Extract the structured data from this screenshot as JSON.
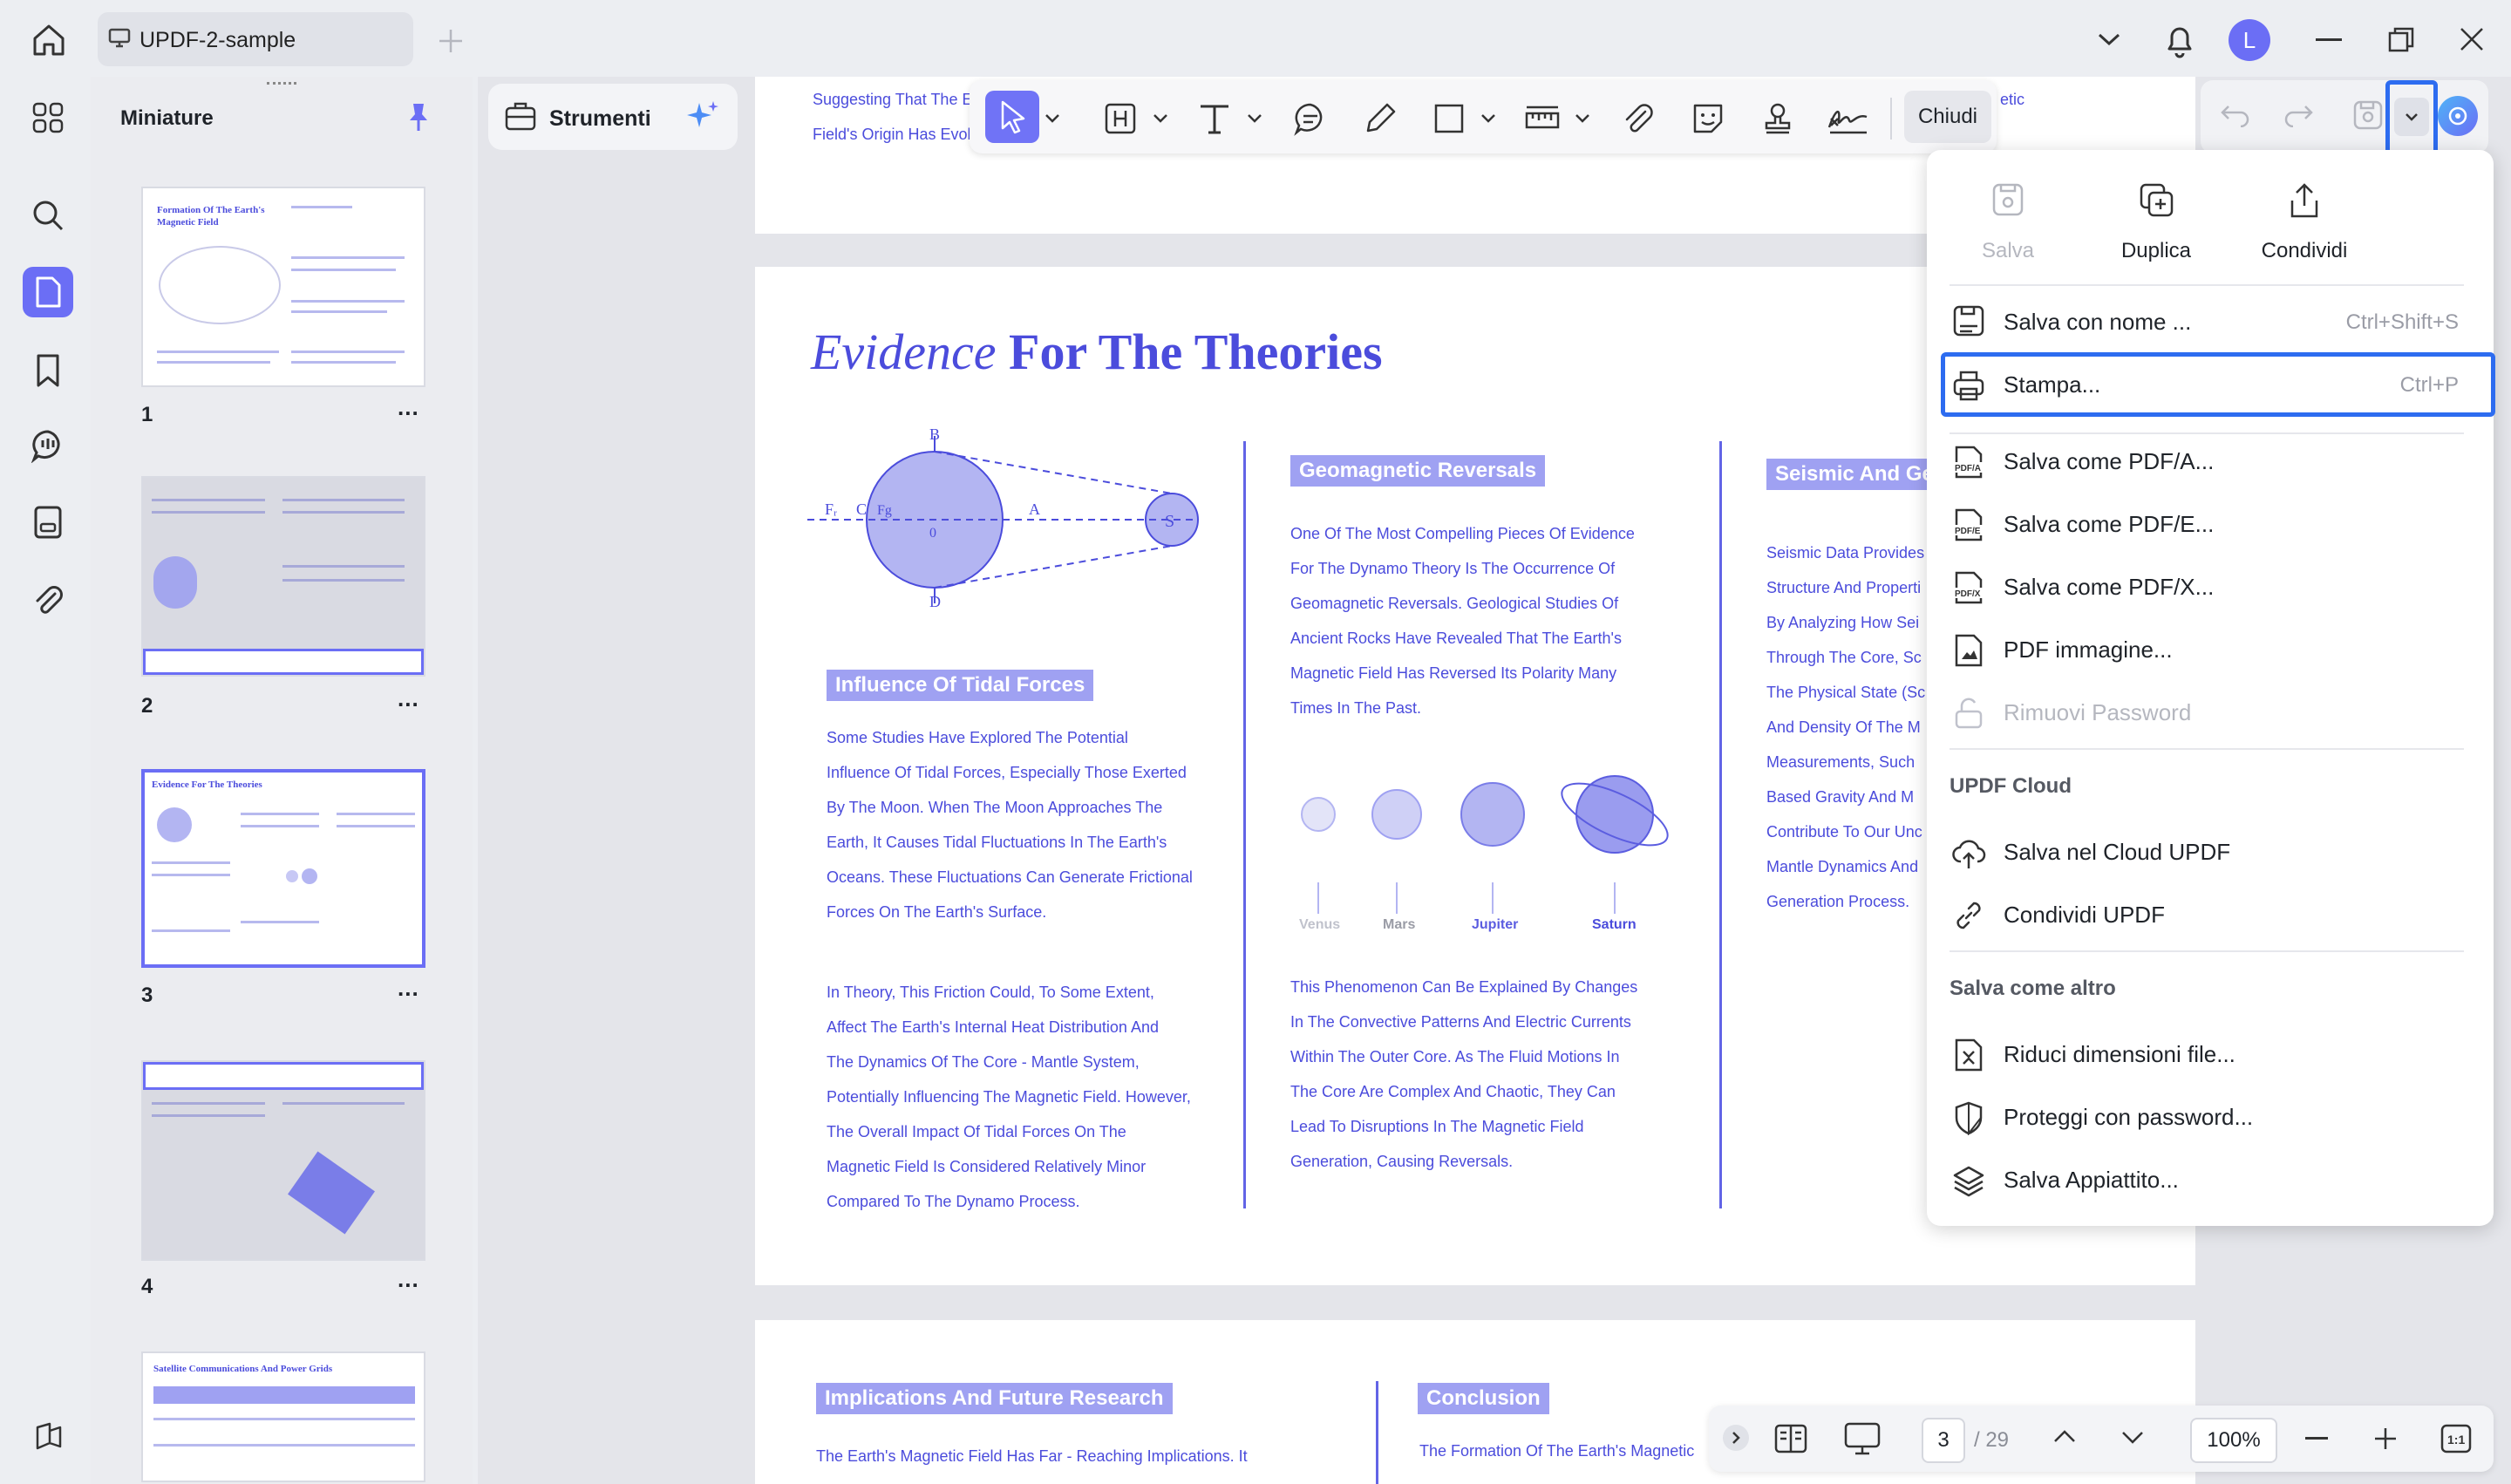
{
  "window": {
    "tab_title": "UPDF-2-sample",
    "avatar_letter": "L"
  },
  "thumbnails": {
    "title": "Miniature",
    "pages": [
      {
        "num": "1",
        "title": "Formation Of The Earth's Magnetic Field"
      },
      {
        "num": "2",
        "title": ""
      },
      {
        "num": "3",
        "title": "Evidence For The Theories"
      },
      {
        "num": "4",
        "title": ""
      },
      {
        "num": "",
        "title": "Satellite Communications And Power Grids"
      }
    ],
    "more": "..."
  },
  "tools": {
    "strumenti_label": "Strumenti",
    "chiudi_label": "Chiudi"
  },
  "document": {
    "top_fragment_1": "Suggesting That The E",
    "top_fragment_2": "Field's Origin Has Evol",
    "top_fragment_3": "etic",
    "page_title_italic": "Evidence",
    "page_title_bold": "For The Theories",
    "tidal_heading": "Influence Of Tidal Forces",
    "tidal_p1": [
      "Some Studies Have Explored The Potential",
      "Influence Of Tidal Forces, Especially Those Exerted",
      "By The Moon. When The Moon Approaches The",
      "Earth, It Causes Tidal Fluctuations In The Earth's",
      "Oceans. These Fluctuations Can Generate Frictional",
      "Forces On The Earth's Surface."
    ],
    "tidal_p2": [
      "In Theory, This Friction Could, To Some Extent,",
      "Affect The Earth's Internal Heat Distribution And",
      "The Dynamics Of The Core - Mantle System,",
      "Potentially Influencing The Magnetic Field. However,",
      "The Overall Impact Of Tidal Forces On The",
      "Magnetic Field Is Considered Relatively Minor",
      "Compared To The Dynamo Process."
    ],
    "geo_heading": "Geomagnetic Reversals",
    "geo_p1": [
      "One Of The Most Compelling Pieces Of Evidence",
      "For The Dynamo Theory Is The Occurrence Of",
      "Geomagnetic Reversals. Geological Studies Of",
      "Ancient Rocks Have Revealed That The Earth's",
      "Magnetic Field Has Reversed Its Polarity Many",
      "Times In The Past."
    ],
    "planets": [
      "Venus",
      "Mars",
      "Jupiter",
      "Saturn"
    ],
    "geo_p2": [
      "This Phenomenon Can Be Explained By Changes",
      "In The Convective Patterns And Electric Currents",
      "Within The Outer Core. As The Fluid Motions In",
      "The Core Are Complex And Chaotic, They Can",
      "Lead To Disruptions In The Magnetic Field",
      "Generation, Causing Reversals."
    ],
    "seismic_heading": "Seismic And Ge",
    "seismic_p": [
      "Seismic Data Provides",
      "Structure And Properti",
      "By Analyzing How Sei",
      "Through The Core, Sc",
      "The Physical State (Sc",
      "And Density Of The M",
      "Measurements, Such",
      "Based Gravity And M",
      "Contribute To Our Unc",
      "Mantle Dynamics And",
      "Generation Process."
    ],
    "diagram_labels": {
      "fr": "Fᵣ",
      "c": "C",
      "fg": "Fg",
      "b": "B",
      "zero": "0",
      "a": "A",
      "d": "D",
      "s": "S"
    },
    "next_heading_1": "Implications And Future Research",
    "next_text_1": "The Earth's Magnetic Field Has Far - Reaching Implications. It",
    "next_heading_2": "Conclusion",
    "next_text_2": "The Formation Of The Earth's Magnetic"
  },
  "menu": {
    "quick": [
      {
        "label": "Salva",
        "disabled": true
      },
      {
        "label": "Duplica",
        "disabled": false
      },
      {
        "label": "Condividi",
        "disabled": false
      }
    ],
    "items": [
      {
        "label": "Salva con nome ...",
        "shortcut": "Ctrl+Shift+S"
      },
      {
        "label": "Stampa...",
        "shortcut": "Ctrl+P"
      },
      {
        "label": "Salva come PDF/A...",
        "shortcut": ""
      },
      {
        "label": "Salva come PDF/E...",
        "shortcut": ""
      },
      {
        "label": "Salva come PDF/X...",
        "shortcut": ""
      },
      {
        "label": "PDF immagine...",
        "shortcut": ""
      },
      {
        "label": "Rimuovi Password",
        "shortcut": ""
      }
    ],
    "cloud_heading": "UPDF Cloud",
    "cloud_items": [
      "Salva nel Cloud UPDF",
      "Condividi UPDF"
    ],
    "other_heading": "Salva come altro",
    "other_items": [
      "Riduci dimensioni file...",
      "Proteggi con password...",
      "Salva Appiattito..."
    ]
  },
  "pager": {
    "current": "3",
    "total": "/ 29",
    "zoom": "100%"
  },
  "colors": {
    "accent": "#6b6ef5",
    "doc_text": "#4b4cdc",
    "highlight": "#2d6cf0"
  }
}
